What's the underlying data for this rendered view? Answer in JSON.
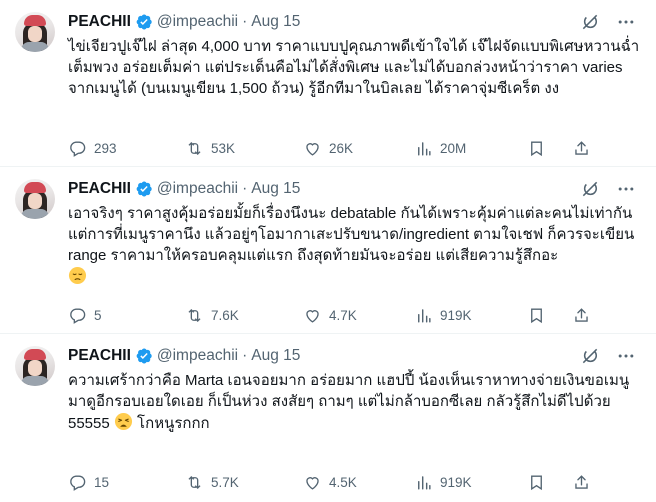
{
  "tweets": [
    {
      "name": "PEACHII",
      "handle": "@impeachii",
      "separator": "·",
      "date": "Aug 15",
      "text": "ไข่เจียวปูเจ๊ไฝ ล่าสุด 4,000 บาท ราคาแบบปูคุณภาพดีเข้าใจได้ เจ๊ไฝจัดแบบพิเศษหวานฉ่ำเต็มพวง อร่อยเต็มค่า แต่ประเด็นคือไม่ได้สั่งพิเศษ และไม่ได้บอกล่วงหน้าว่าราคา varies จากเมนูได้ (บนเมนูเขียน 1,500 ถ้วน) รู้อีกทีมาในบิลเลย ได้ราคาจุ่มซีเคร็ต งง",
      "emoji": "",
      "text_after": "",
      "replies": "293",
      "reposts": "53K",
      "likes": "26K",
      "views": "20M"
    },
    {
      "name": "PEACHII",
      "handle": "@impeachii",
      "separator": "·",
      "date": "Aug 15",
      "text": "เอาจริงๆ ราคาสูงคุ้มอร่อยมั้ยก็เรื่องนึงนะ debatable กันได้เพราะคุ้มค่าแต่ละคนไม่เท่ากัน แต่การที่เมนูราคานึง แล้วอยู่ๆโอมากาเสะปรับขนาด/ingredient ตามใจเชฟ ก็ควรจะเขียน range ราคามาให้ครอบคลุมแต่แรก ถึงสุดท้ายมันจะอร่อย แต่เสียความรู้สึกอะ",
      "emoji": "pensive-face",
      "text_after": "",
      "replies": "5",
      "reposts": "7.6K",
      "likes": "4.7K",
      "views": "919K"
    },
    {
      "name": "PEACHII",
      "handle": "@impeachii",
      "separator": "·",
      "date": "Aug 15",
      "text": "ความเศร้ากว่าคือ Marta เอนจอยมาก อร่อยมาก แฮปปี้ น้องเห็นเราหาทางจ่ายเงินขอเมนูมาดูอีกรอบเอยใดเอย ก็เป็นห่วง สงสัยๆ ถามๆ แต่ไม่กล้าบอกซีเลย กลัวรู้สึกไม่ดีไปด้วย 55555",
      "emoji": "weary-face",
      "text_after": " โกหนูรกกก",
      "replies": "15",
      "reposts": "5.7K",
      "likes": "4.5K",
      "views": "919K"
    }
  ],
  "colors": {
    "verified": "#1d9bf0",
    "muted": "#536471",
    "text": "#0f1419",
    "divider": "#eff3f4"
  },
  "icons": {
    "verified": "verified-badge-icon",
    "grok": "grok-icon",
    "more": "more-icon",
    "reply": "reply-icon",
    "repost": "repost-icon",
    "like": "heart-icon",
    "views": "views-icon",
    "bookmark": "bookmark-icon",
    "share": "share-icon"
  }
}
